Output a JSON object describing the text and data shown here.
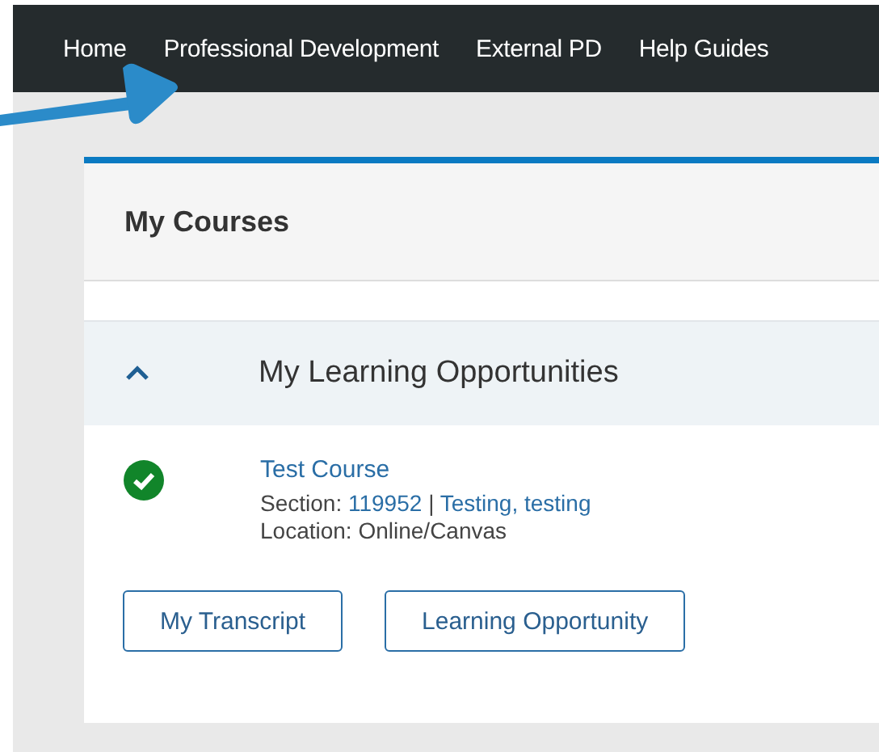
{
  "nav": {
    "items": [
      {
        "label": "Home"
      },
      {
        "label": "Professional Development"
      },
      {
        "label": "External PD"
      },
      {
        "label": "Help Guides"
      }
    ]
  },
  "card": {
    "title": "My Courses",
    "section": {
      "title": "My Learning Opportunities",
      "expanded": true,
      "courses": [
        {
          "completed": true,
          "name": "Test Course",
          "section_label": "Section:",
          "section_number": "119952",
          "separator": "|",
          "instructor": "Testing, testing",
          "location": "Location: Online/Canvas"
        }
      ]
    },
    "buttons": [
      {
        "label": "My Transcript"
      },
      {
        "label": "Learning Opportunity"
      }
    ]
  }
}
